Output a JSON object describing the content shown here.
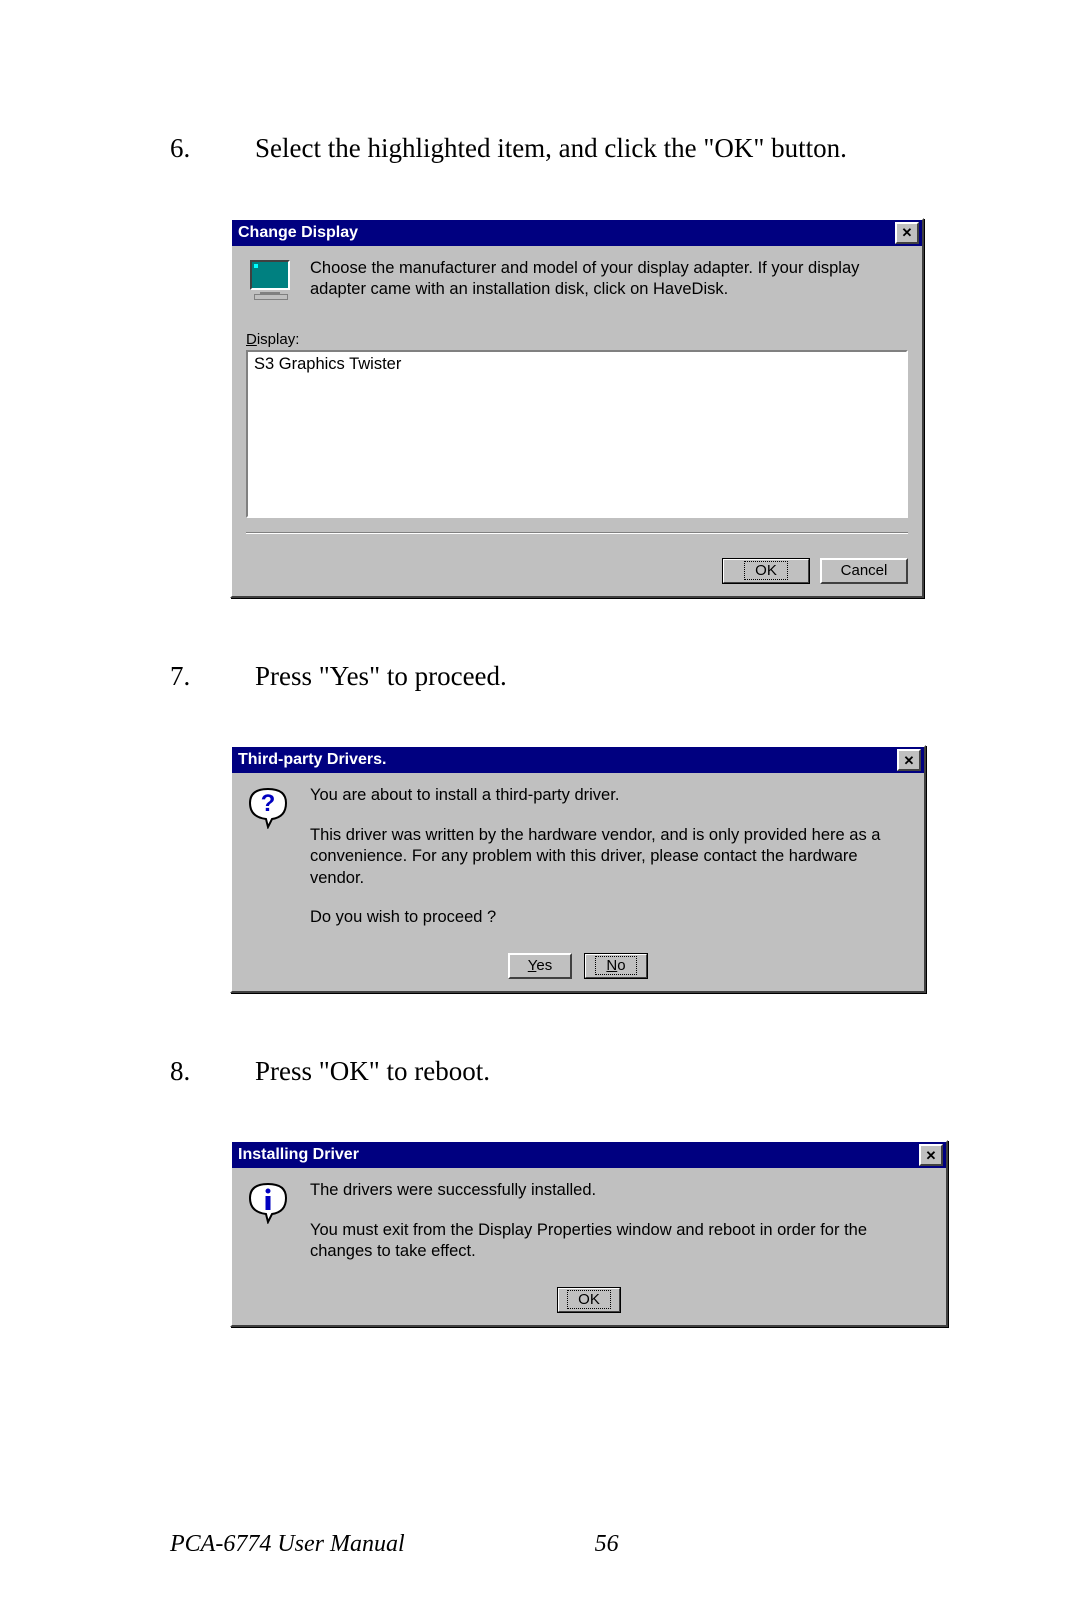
{
  "steps": {
    "s6": {
      "num": "6.",
      "text": "Select the highlighted item, and click the \"OK\" button."
    },
    "s7": {
      "num": "7.",
      "text": "Press \"Yes\" to proceed."
    },
    "s8": {
      "num": "8.",
      "text": "Press \"OK\" to reboot."
    }
  },
  "dlg1": {
    "title": "Change Display",
    "instruction": "Choose the manufacturer and model of your display adapter.  If your display adapter came with an installation disk, click on HaveDisk.",
    "display_label_pre": "D",
    "display_label_rest": "isplay:",
    "list_item": "S3 Graphics Twister",
    "ok": "OK",
    "cancel": "Cancel"
  },
  "dlg2": {
    "title": "Third-party Drivers.",
    "line1": "You are about to install a third-party driver.",
    "line2": "This driver was written by the hardware vendor, and is only provided here as a convenience.  For any problem with this driver, please contact the hardware vendor.",
    "line3": "Do you wish to proceed ?",
    "yes_pre": "Y",
    "yes_rest": "es",
    "no_pre": "N",
    "no_rest": "o"
  },
  "dlg3": {
    "title": "Installing Driver",
    "line1": "The drivers were successfully installed.",
    "line2": "You must exit from the Display Properties window and reboot in order for the changes to take effect.",
    "ok": "OK"
  },
  "footer": {
    "manual": "PCA-6774 User Manual",
    "page": "56"
  }
}
